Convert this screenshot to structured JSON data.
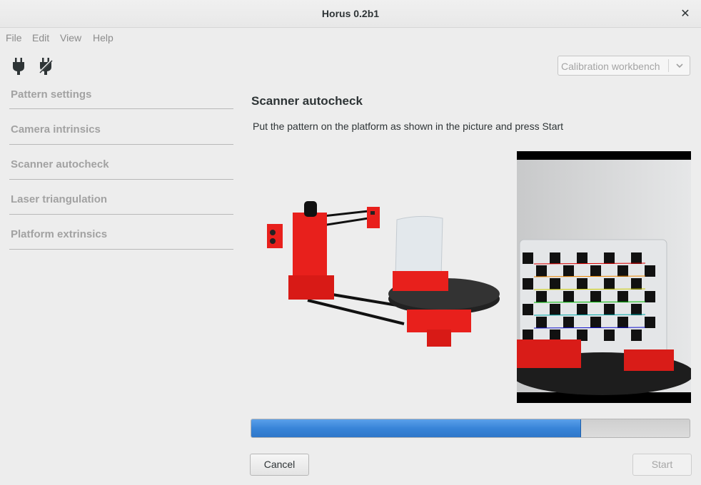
{
  "window": {
    "title": "Horus 0.2b1",
    "close_glyph": "✕"
  },
  "menu": [
    "File",
    "Edit",
    "View",
    "Help"
  ],
  "toolbar": {
    "connect_icon": "plug-connect-icon",
    "disconnect_icon": "plug-disconnect-icon"
  },
  "workbench_selector": {
    "value": "Calibration workbench"
  },
  "sidebar": {
    "items": [
      {
        "label": "Pattern settings"
      },
      {
        "label": "Camera intrinsics"
      },
      {
        "label": "Scanner autocheck"
      },
      {
        "label": "Laser triangulation"
      },
      {
        "label": "Platform extrinsics"
      }
    ]
  },
  "main": {
    "title": "Scanner autocheck",
    "instruction": "Put the pattern on the platform as shown in the picture and press Start",
    "progress_percent": 75
  },
  "buttons": {
    "cancel": "Cancel",
    "start": "Start"
  },
  "colors": {
    "scanner_red": "#e8201c",
    "progress_blue": "#3884d8"
  }
}
